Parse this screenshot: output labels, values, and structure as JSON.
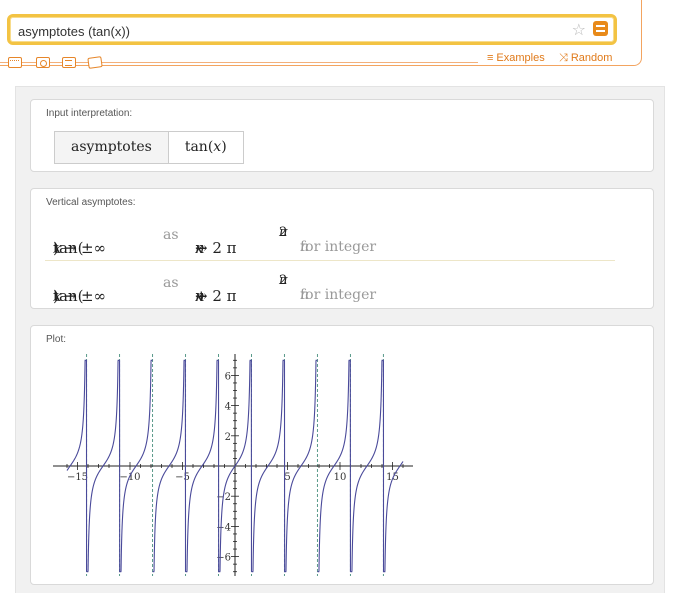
{
  "search": {
    "query": "asymptotes (tan(x))",
    "star_icon": "star-icon",
    "equals_icon": "equals-icon"
  },
  "toolbar": {
    "icons": [
      "keyboard-icon",
      "camera-icon",
      "list-icon",
      "pictures-icon"
    ],
    "examples_label": "Examples",
    "random_label": "Random"
  },
  "pods": {
    "input": {
      "title": "Input interpretation:",
      "cell1": "asymptotes",
      "cell2_prefix": "tan(",
      "cell2_var": "x",
      "cell2_suffix": ")"
    },
    "asymptotes": {
      "title": "Vertical asymptotes:",
      "rows": [
        {
          "lhs_pre": "tan(",
          "lhs_var": "x",
          "lhs_post": ") → ±∞",
          "as_word": "as",
          "rhs_var": "x",
          "rhs_mid": " → 2 π ",
          "rhs_n": "n",
          "rhs_op": " −",
          "frac_num": "π",
          "frac_den": "2",
          "cond_text": "for integer ",
          "cond_var": "n"
        },
        {
          "lhs_pre": "tan(",
          "lhs_var": "x",
          "lhs_post": ") → ±∞",
          "as_word": "as",
          "rhs_var": "x",
          "rhs_mid": " → 2 π ",
          "rhs_n": "n",
          "rhs_op": " +",
          "frac_num": "π",
          "frac_den": "2",
          "cond_text": "for integer ",
          "cond_var": "n"
        }
      ]
    },
    "plot": {
      "title": "Plot:"
    }
  },
  "chart_data": {
    "type": "line",
    "function": "tan(x)",
    "xlim": [
      -16,
      16
    ],
    "ylim": [
      -7,
      7
    ],
    "xticks": [
      -15,
      -10,
      -5,
      5,
      10,
      15
    ],
    "xtick_labels": [
      "−15",
      "−10",
      "−5",
      "5",
      "10",
      "15"
    ],
    "yticks": [
      -6,
      -4,
      -2,
      2,
      4,
      6
    ],
    "ytick_labels": [
      "−6",
      "−4",
      "−2",
      "2",
      "4",
      "6"
    ],
    "asymptotes_x": [
      -14.137,
      -10.996,
      -7.854,
      -4.712,
      -1.571,
      1.571,
      4.712,
      7.854,
      10.996,
      14.137
    ],
    "colors": {
      "curve": "#4a4a9a",
      "asymptote": "#5a9a8a",
      "axis": "#222222"
    },
    "grid": false
  }
}
